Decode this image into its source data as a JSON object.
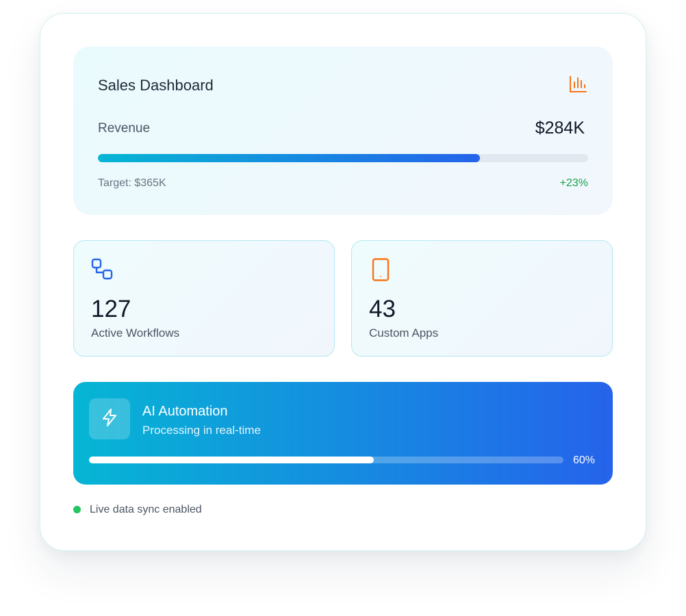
{
  "sales": {
    "title": "Sales Dashboard",
    "icon": "bar-chart-icon",
    "revenue_label": "Revenue",
    "revenue_value": "$284K",
    "revenue_progress": 0.78,
    "target_text": "Target: $365K",
    "growth_text": "+23%"
  },
  "stats": [
    {
      "icon": "workflow-icon",
      "value": "127",
      "label": "Active Workflows"
    },
    {
      "icon": "tablet-icon",
      "value": "43",
      "label": "Custom Apps"
    }
  ],
  "ai": {
    "icon": "lightning-icon",
    "title": "AI Automation",
    "subtitle": "Processing in real-time",
    "progress": 0.6,
    "percent_text": "60%"
  },
  "sync": {
    "label": "Live data sync enabled"
  },
  "colors": {
    "accent_cyan": "#06b6d4",
    "accent_blue": "#2563eb",
    "orange": "#f97316",
    "growth_green": "#16a34a",
    "sync_green": "#22c55e"
  }
}
